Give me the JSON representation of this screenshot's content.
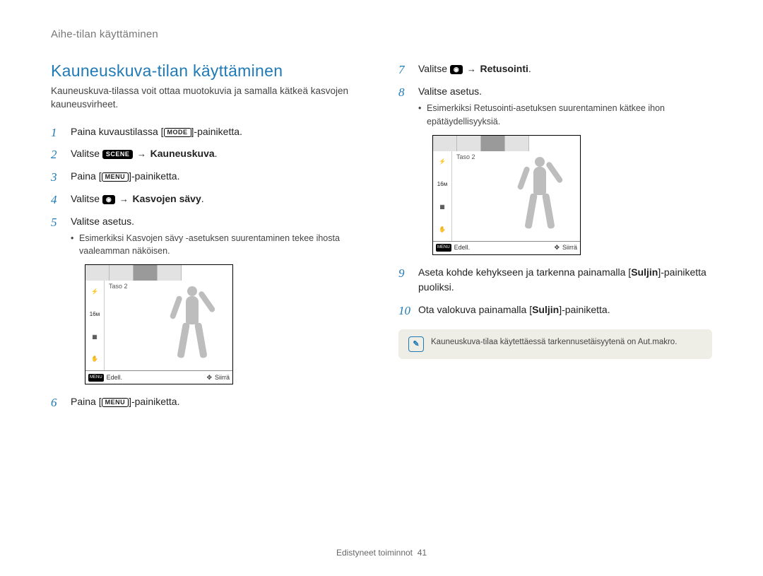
{
  "breadcrumb": "Aihe-tilan käyttäminen",
  "title": "Kauneuskuva-tilan käyttäminen",
  "intro": "Kauneuskuva-tilassa voit ottaa muotokuvia ja samalla kätkeä kasvojen kauneusvirheet.",
  "icons": {
    "mode": "MODE",
    "menu": "MENU",
    "scene": "SCENE",
    "camera": "◉"
  },
  "steps": {
    "s1_a": "Paina kuvaustilassa [",
    "s1_b": "]-painiketta.",
    "s2_a": "Valitse ",
    "s2_b": " → ",
    "s2_c": "Kauneuskuva",
    "s2_d": ".",
    "s3_a": "Paina [",
    "s3_b": "]-painiketta.",
    "s4_a": "Valitse ",
    "s4_b": " → ",
    "s4_c": "Kasvojen sävy",
    "s4_d": ".",
    "s5": "Valitse asetus.",
    "s5_sub": "Esimerkiksi Kasvojen sävy -asetuksen suurentaminen tekee ihosta vaaleamman näköisen.",
    "s6_a": "Paina [",
    "s6_b": "]-painiketta.",
    "s7_a": "Valitse ",
    "s7_b": " → ",
    "s7_c": "Retusointi",
    "s7_d": ".",
    "s8": "Valitse asetus.",
    "s8_sub": "Esimerkiksi Retusointi-asetuksen suurentaminen kätkee ihon epätäydellisyyksiä.",
    "s9_a": "Aseta kohde kehykseen ja tarkenna painamalla [",
    "s9_b": "Suljin",
    "s9_c": "]-painiketta puoliksi.",
    "s10_a": "Ota valokuva painamalla [",
    "s10_b": "Suljin",
    "s10_c": "]-painiketta."
  },
  "mock": {
    "level": "Taso 2",
    "back": "Edell.",
    "move": "Siirrä"
  },
  "note": "Kauneuskuva-tilaa käytettäessä tarkennusetäisyytenä on Aut.makro.",
  "footer_a": "Edistyneet toiminnot",
  "footer_b": "41"
}
